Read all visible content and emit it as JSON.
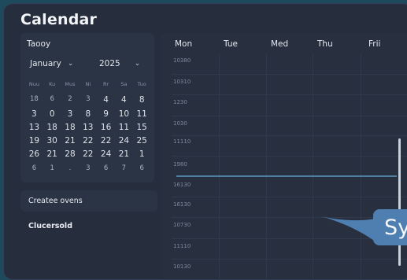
{
  "app": {
    "title": "Calendar"
  },
  "mini_calendar": {
    "today_label": "Taooy",
    "month": "January",
    "year": "2025",
    "dow": [
      "Nuu",
      "Ku",
      "Mus",
      "Ni",
      "Rr",
      "Sa",
      "Tuo"
    ],
    "weeks": [
      [
        "18",
        "6",
        "2",
        "3",
        "4",
        "4",
        "8"
      ],
      [
        "3",
        "0",
        "3",
        "8",
        "9",
        "10",
        "11"
      ],
      [
        "13",
        "18",
        "18",
        "13",
        "16",
        "11",
        "15"
      ],
      [
        "19",
        "30",
        "21",
        "22",
        "22",
        "24",
        "25"
      ],
      [
        "26",
        "21",
        "28",
        "22",
        "24",
        "21",
        "1"
      ],
      [
        "6",
        "1",
        ".",
        "3",
        "6",
        "7",
        "6"
      ]
    ]
  },
  "sidebar": {
    "create_button": "Createe ovens",
    "section_label": "Clucersold"
  },
  "week_view": {
    "days": [
      "Mon",
      "Tue",
      "Med",
      "Thu",
      "Frii"
    ],
    "times": [
      "10380",
      "10310",
      "1230",
      "1030",
      "11110",
      "1980",
      "16130",
      "16130",
      "10730",
      "11110",
      "10130"
    ]
  },
  "popup": {
    "text": "Sy"
  },
  "colors": {
    "accent": "#4f7fb0",
    "now_line": "#4f7ea3",
    "background": "#1d4a5c",
    "window": "#262e3e"
  }
}
